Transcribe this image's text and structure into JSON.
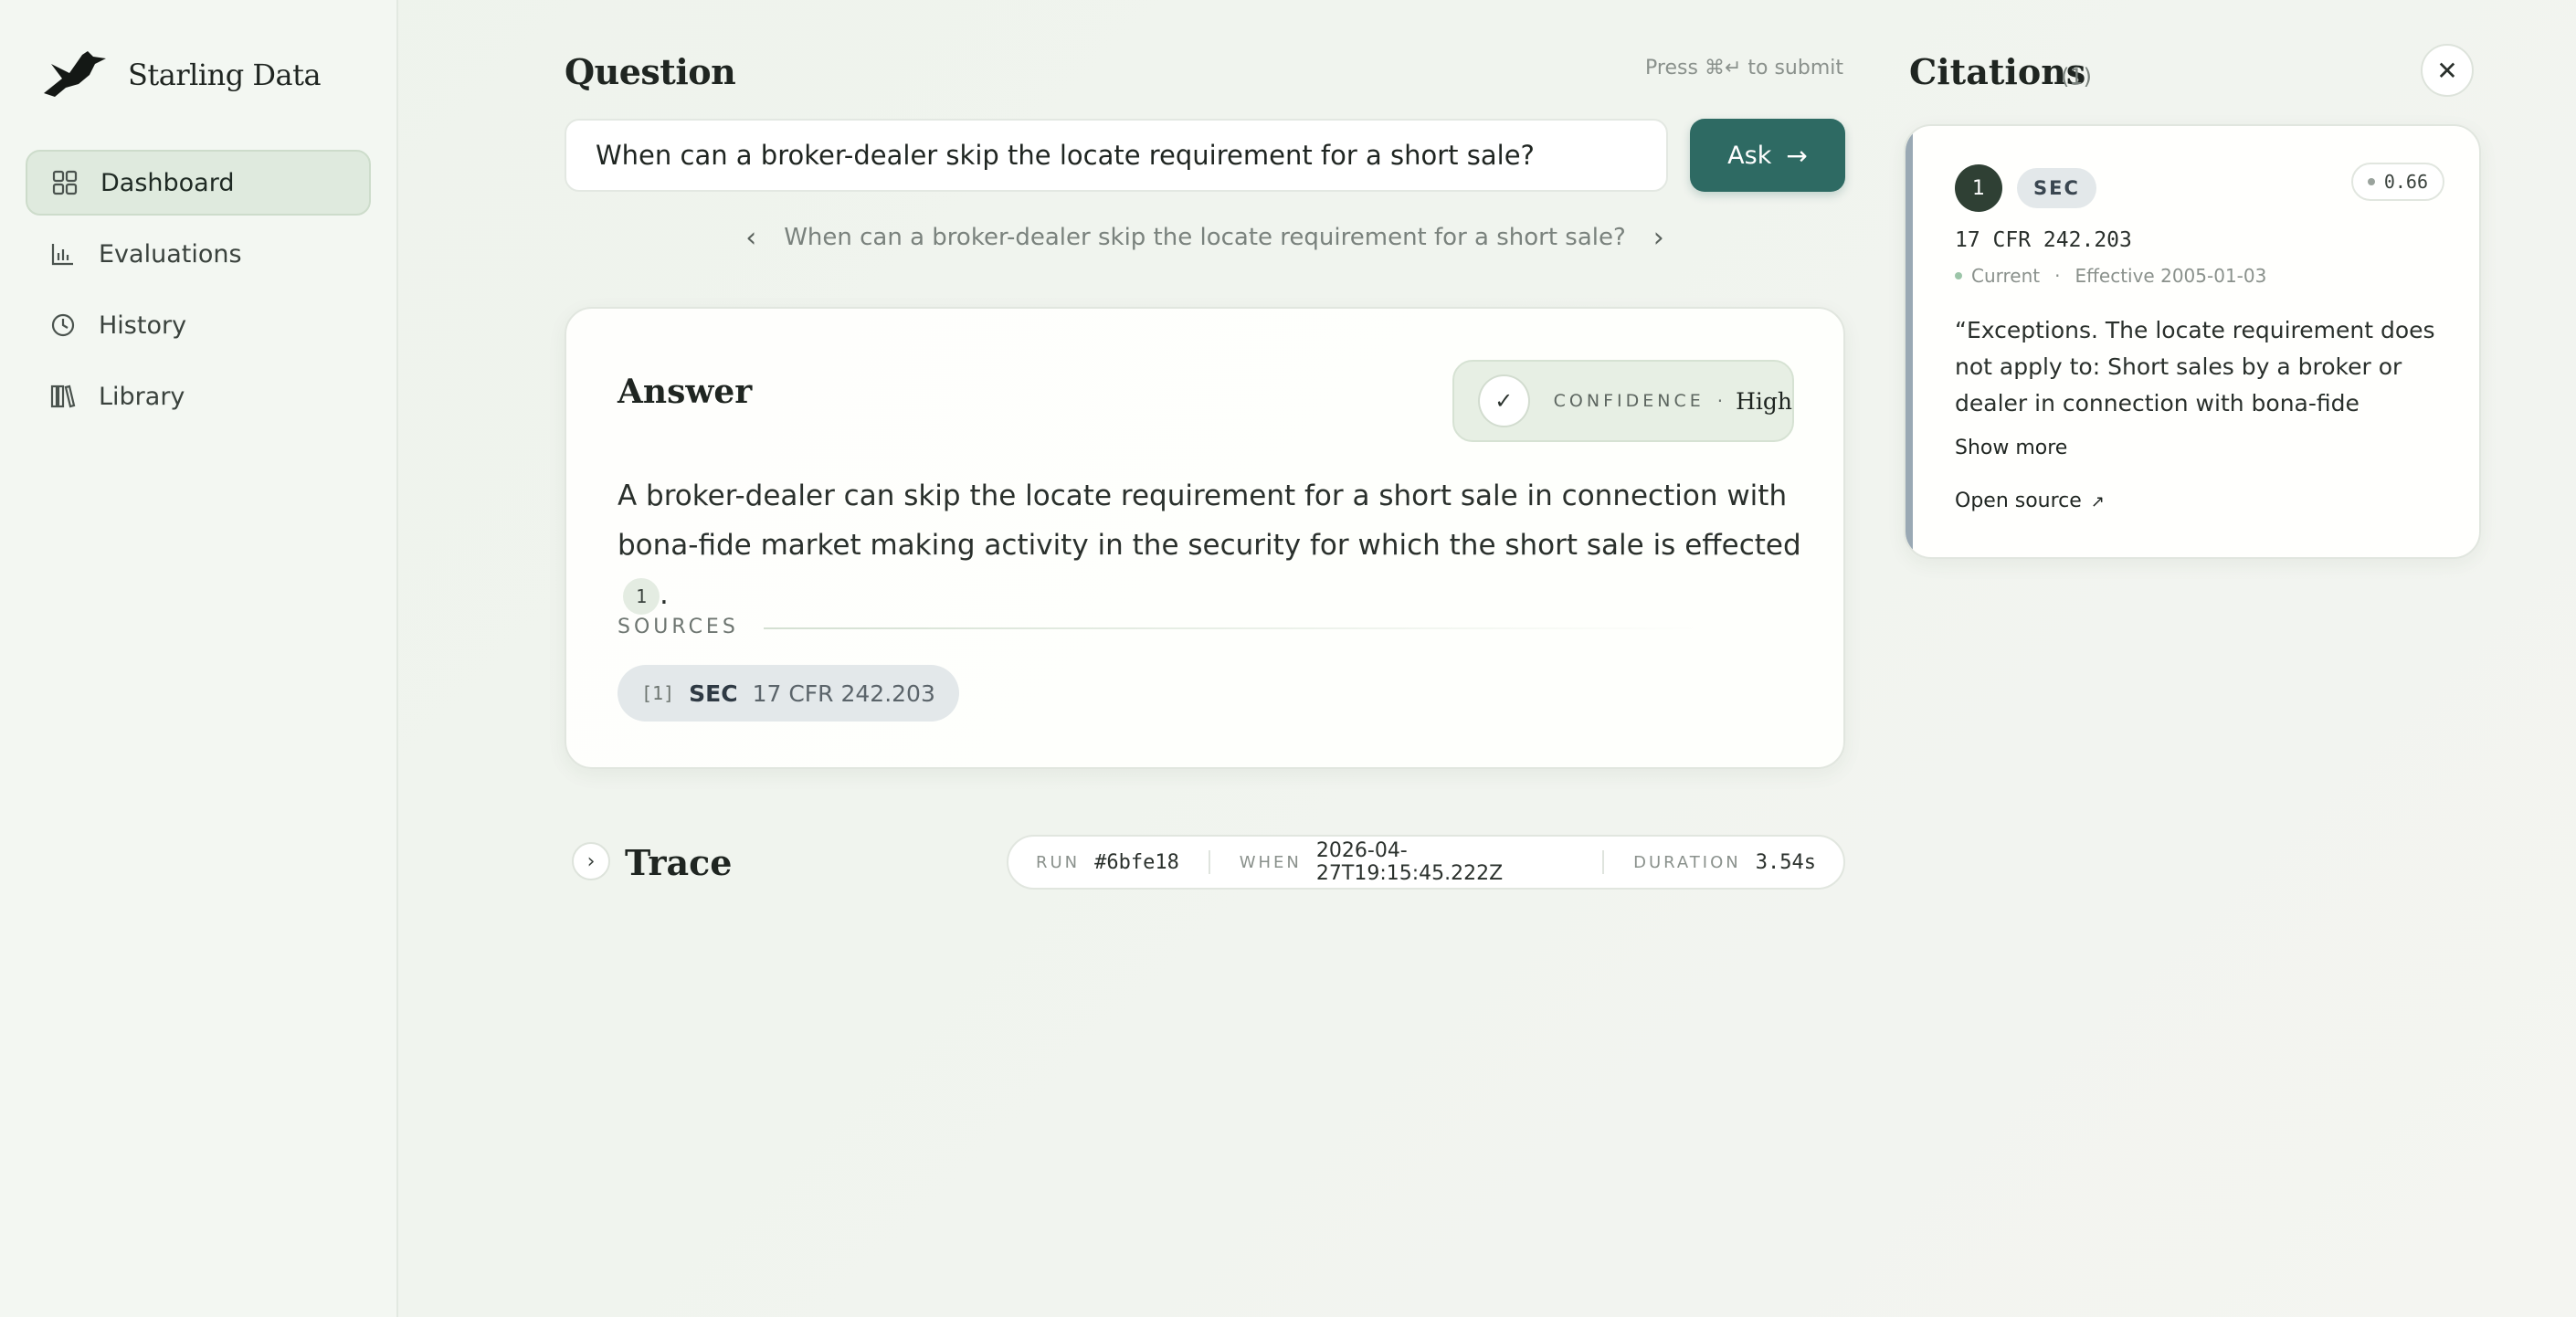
{
  "brand": {
    "name": "Starling Data"
  },
  "sidebar": {
    "items": [
      {
        "label": "Dashboard",
        "icon": "grid-icon",
        "active": true
      },
      {
        "label": "Evaluations",
        "icon": "bar-chart-icon"
      },
      {
        "label": "History",
        "icon": "clock-icon"
      },
      {
        "label": "Library",
        "icon": "books-icon"
      }
    ]
  },
  "question": {
    "title": "Question",
    "hint": "Press ⌘↵ to submit",
    "value": "When can a broker-dealer skip the locate requirement for a short sale?",
    "ask_label": "Ask",
    "history_text": "When can a broker-dealer skip the locate requirement for a short sale?"
  },
  "answer": {
    "title": "Answer",
    "confidence_label": "CONFIDENCE",
    "confidence_sep": "·",
    "confidence_value": "High",
    "text": "A broker-dealer can skip the locate requirement for a short sale in connection with bona-fide market making activity in the security for which the short sale is effected",
    "citation_marker": "1",
    "text_end": ".",
    "sources_label": "SOURCES",
    "sources": [
      {
        "num": "[1]",
        "agency": "SEC",
        "ref": "17 CFR 242.203"
      }
    ]
  },
  "trace": {
    "title": "Trace",
    "run_label": "RUN",
    "run_value": "#6bfe18",
    "when_label": "WHEN",
    "when_value": "2026-04-27T19:15:45.222Z",
    "duration_label": "DURATION",
    "duration_value": "3.54s"
  },
  "citations": {
    "title": "Citations",
    "count": "(1)",
    "items": [
      {
        "num": "1",
        "agency": "SEC",
        "score": "0.66",
        "ref": "17 CFR 242.203",
        "status": "Current",
        "effective": "Effective 2005-01-03",
        "quote": "“Exceptions. The locate requirement does not apply to: Short sales by a broker or dealer in connection with bona-fide market…",
        "show_more": "Show more",
        "open_source": "Open source"
      }
    ]
  },
  "colors": {
    "accent": "#2e6a63",
    "citation_badge": "#2f4034"
  }
}
